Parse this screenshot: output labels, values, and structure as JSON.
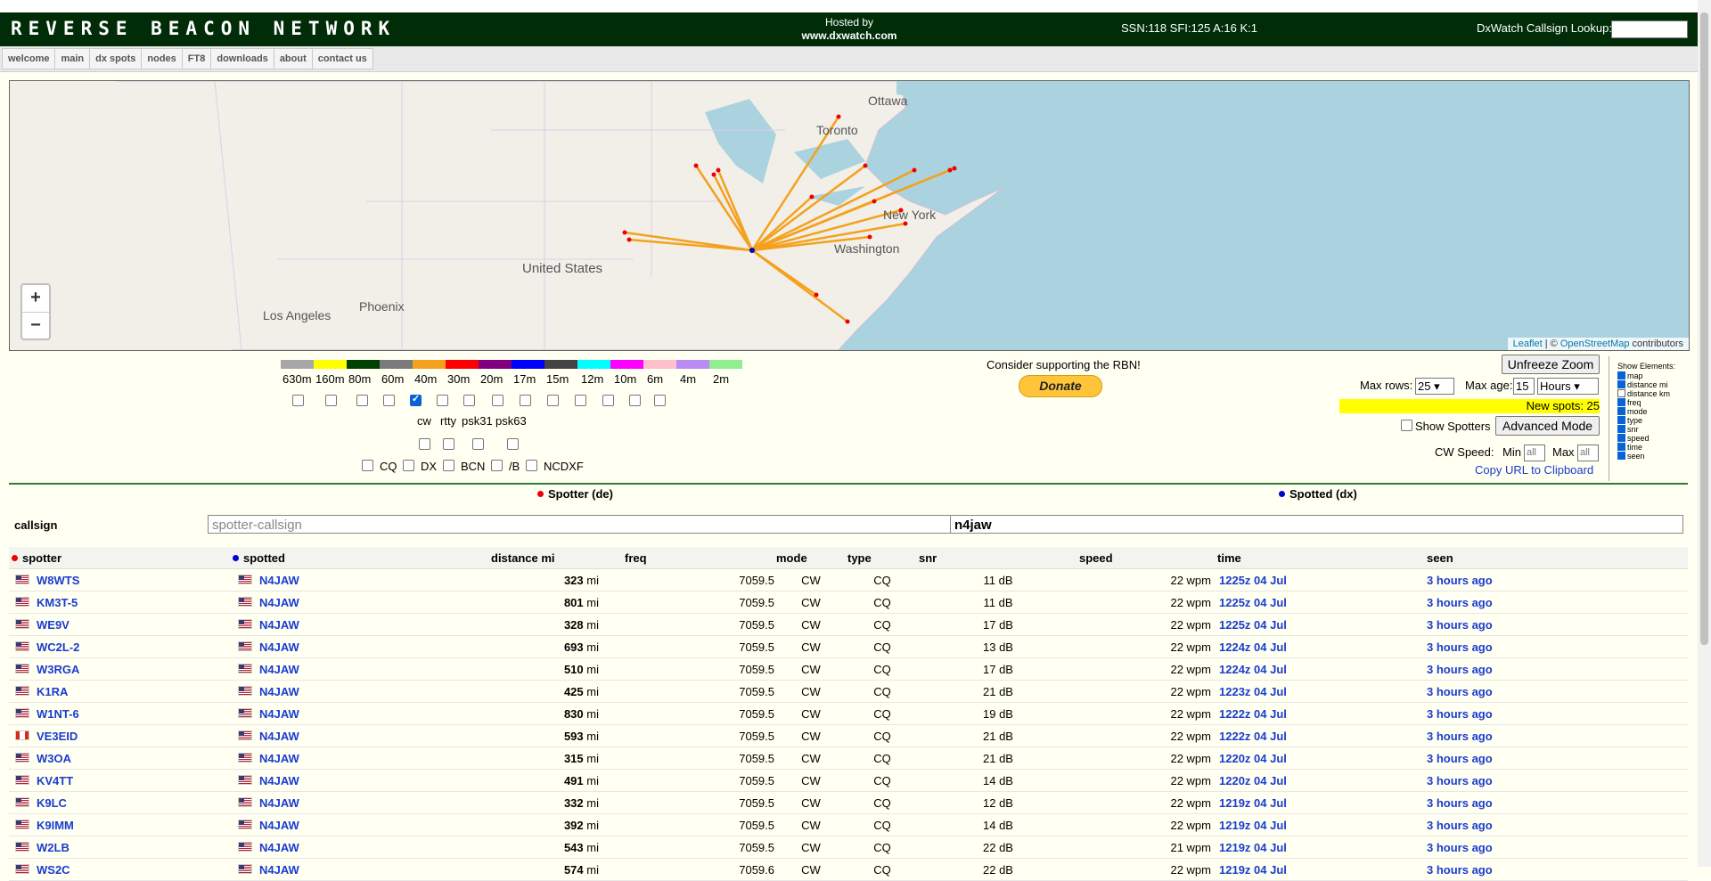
{
  "header": {
    "logo": "REVERSE BEACON NETWORK",
    "hosted_by": "Hosted by",
    "hosted_site": "www.dxwatch.com",
    "solar": "SSN:118 SFI:125 A:16 K:1",
    "lookup_label": "DxWatch Callsign Lookup:",
    "lookup_value": ""
  },
  "nav": [
    "welcome",
    "main",
    "dx spots",
    "nodes",
    "FT8",
    "downloads",
    "about",
    "contact us"
  ],
  "map": {
    "labels": [
      "Ottawa",
      "Toronto",
      "New York",
      "Washington",
      "United States",
      "Phoenix",
      "Los Angeles"
    ],
    "zoom_in": "+",
    "zoom_out": "−",
    "attribution_leaflet": "Leaflet",
    "attribution_sep": " | © ",
    "attribution_osm": "OpenStreetMap",
    "attribution_tail": " contributors"
  },
  "bands": {
    "labels": [
      "630m",
      "160m",
      "80m",
      "60m",
      "40m",
      "30m",
      "20m",
      "17m",
      "15m",
      "12m",
      "10m",
      "6m",
      "4m",
      "2m"
    ],
    "colors": [
      "#a7a7a7",
      "#ffff00",
      "#004000",
      "#7a7a7a",
      "#f4a11d",
      "#ff0000",
      "#800080",
      "#0000ff",
      "#444444",
      "#00ffff",
      "#ff00ff",
      "#ffc0cb",
      "#b98cf5",
      "#90ee90"
    ],
    "checked": [
      false,
      false,
      false,
      false,
      true,
      false,
      false,
      false,
      false,
      false,
      false,
      false,
      false,
      false
    ]
  },
  "modes": {
    "labels": [
      "cw",
      "rtty",
      "psk31",
      "psk63"
    ],
    "checked": [
      false,
      false,
      false,
      false
    ]
  },
  "types": {
    "labels": [
      "CQ",
      "DX",
      "BCN",
      "/B",
      "NCDXF"
    ],
    "checked": [
      false,
      false,
      false,
      false,
      false
    ]
  },
  "support": {
    "text": "Consider supporting the RBN!",
    "donate": "Donate"
  },
  "controls": {
    "unfreeze": "Unfreeze Zoom",
    "max_rows_label": "Max rows:",
    "max_rows": "25",
    "max_age_label": "Max age:",
    "max_age": "15",
    "max_age_unit": "Hours",
    "new_spots": "New spots: 25",
    "show_spotters": "Show Spotters",
    "advanced": "Advanced Mode",
    "cw_speed": "CW Speed:",
    "min_label": "Min",
    "max_label": "Max",
    "min_value": "all",
    "max_value": "all",
    "copy_url": "Copy URL to Clipboard"
  },
  "show_elements": {
    "title": "Show Elements:",
    "items": [
      "map",
      "distance mi",
      "distance km",
      "freq",
      "mode",
      "type",
      "snr",
      "speed",
      "time",
      "seen"
    ],
    "checked": [
      true,
      true,
      false,
      true,
      true,
      true,
      true,
      true,
      true,
      true
    ]
  },
  "filters": {
    "spotter_heading": "Spotter (de)",
    "spotted_heading": "Spotted (dx)",
    "callsign_label": "callsign",
    "spotter_placeholder": "spotter-callsign",
    "spotted_value": "n4jaw"
  },
  "table": {
    "headers": [
      "spotter",
      "spotted",
      "distance mi",
      "freq",
      "mode",
      "type",
      "snr",
      "speed",
      "time",
      "seen"
    ],
    "rows": [
      {
        "flag": "us",
        "spotter": "W8WTS",
        "spotted": "N4JAW",
        "dist": "323",
        "freq": "7059.5",
        "mode": "CW",
        "type": "CQ",
        "snr": "11 dB",
        "speed": "22 wpm",
        "time": "1225z 04 Jul",
        "seen": "3 hours ago"
      },
      {
        "flag": "us",
        "spotter": "KM3T-5",
        "spotted": "N4JAW",
        "dist": "801",
        "freq": "7059.5",
        "mode": "CW",
        "type": "CQ",
        "snr": "11 dB",
        "speed": "22 wpm",
        "time": "1225z 04 Jul",
        "seen": "3 hours ago"
      },
      {
        "flag": "us",
        "spotter": "WE9V",
        "spotted": "N4JAW",
        "dist": "328",
        "freq": "7059.5",
        "mode": "CW",
        "type": "CQ",
        "snr": "17 dB",
        "speed": "22 wpm",
        "time": "1225z 04 Jul",
        "seen": "3 hours ago"
      },
      {
        "flag": "us",
        "spotter": "WC2L-2",
        "spotted": "N4JAW",
        "dist": "693",
        "freq": "7059.5",
        "mode": "CW",
        "type": "CQ",
        "snr": "13 dB",
        "speed": "22 wpm",
        "time": "1224z 04 Jul",
        "seen": "3 hours ago"
      },
      {
        "flag": "us",
        "spotter": "W3RGA",
        "spotted": "N4JAW",
        "dist": "510",
        "freq": "7059.5",
        "mode": "CW",
        "type": "CQ",
        "snr": "17 dB",
        "speed": "22 wpm",
        "time": "1224z 04 Jul",
        "seen": "3 hours ago"
      },
      {
        "flag": "us",
        "spotter": "K1RA",
        "spotted": "N4JAW",
        "dist": "425",
        "freq": "7059.5",
        "mode": "CW",
        "type": "CQ",
        "snr": "21 dB",
        "speed": "22 wpm",
        "time": "1223z 04 Jul",
        "seen": "3 hours ago"
      },
      {
        "flag": "us",
        "spotter": "W1NT-6",
        "spotted": "N4JAW",
        "dist": "830",
        "freq": "7059.5",
        "mode": "CW",
        "type": "CQ",
        "snr": "19 dB",
        "speed": "22 wpm",
        "time": "1222z 04 Jul",
        "seen": "3 hours ago"
      },
      {
        "flag": "ca",
        "spotter": "VE3EID",
        "spotted": "N4JAW",
        "dist": "593",
        "freq": "7059.5",
        "mode": "CW",
        "type": "CQ",
        "snr": "21 dB",
        "speed": "22 wpm",
        "time": "1222z 04 Jul",
        "seen": "3 hours ago"
      },
      {
        "flag": "us",
        "spotter": "W3OA",
        "spotted": "N4JAW",
        "dist": "315",
        "freq": "7059.5",
        "mode": "CW",
        "type": "CQ",
        "snr": "21 dB",
        "speed": "22 wpm",
        "time": "1220z 04 Jul",
        "seen": "3 hours ago"
      },
      {
        "flag": "us",
        "spotter": "KV4TT",
        "spotted": "N4JAW",
        "dist": "491",
        "freq": "7059.5",
        "mode": "CW",
        "type": "CQ",
        "snr": "14 dB",
        "speed": "22 wpm",
        "time": "1220z 04 Jul",
        "seen": "3 hours ago"
      },
      {
        "flag": "us",
        "spotter": "K9LC",
        "spotted": "N4JAW",
        "dist": "332",
        "freq": "7059.5",
        "mode": "CW",
        "type": "CQ",
        "snr": "12 dB",
        "speed": "22 wpm",
        "time": "1219z 04 Jul",
        "seen": "3 hours ago"
      },
      {
        "flag": "us",
        "spotter": "K9IMM",
        "spotted": "N4JAW",
        "dist": "392",
        "freq": "7059.5",
        "mode": "CW",
        "type": "CQ",
        "snr": "14 dB",
        "speed": "22 wpm",
        "time": "1219z 04 Jul",
        "seen": "3 hours ago"
      },
      {
        "flag": "us",
        "spotter": "W2LB",
        "spotted": "N4JAW",
        "dist": "543",
        "freq": "7059.5",
        "mode": "CW",
        "type": "CQ",
        "snr": "22 dB",
        "speed": "21 wpm",
        "time": "1219z 04 Jul",
        "seen": "3 hours ago"
      },
      {
        "flag": "us",
        "spotter": "WS2C",
        "spotted": "N4JAW",
        "dist": "574",
        "freq": "7059.6",
        "mode": "CW",
        "type": "CQ",
        "snr": "22 dB",
        "speed": "22 wpm",
        "time": "1219z 04 Jul",
        "seen": "3 hours ago"
      }
    ],
    "dist_unit": "mi"
  }
}
